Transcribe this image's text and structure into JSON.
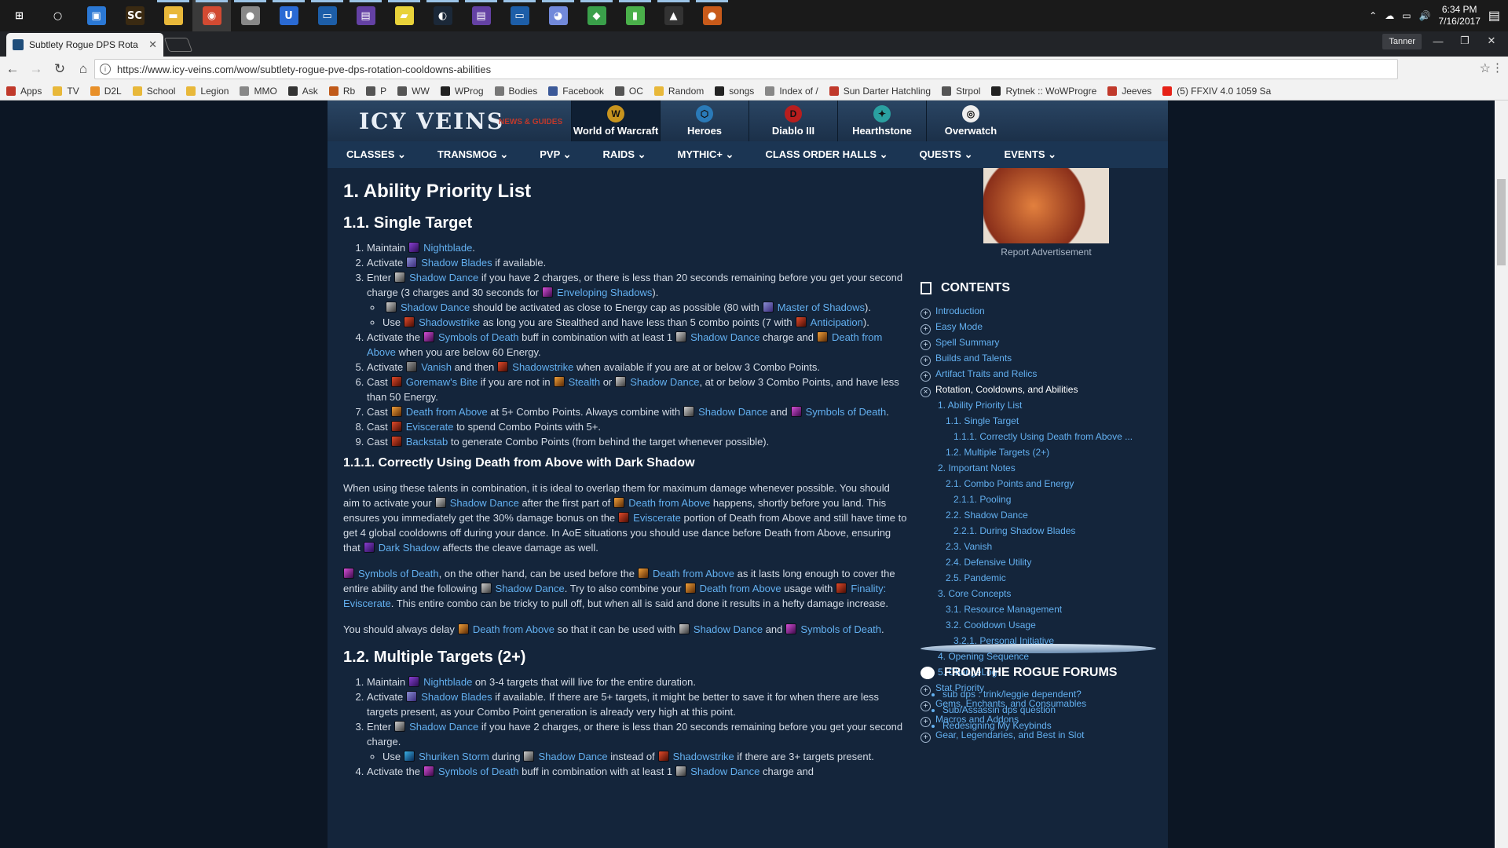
{
  "taskbar": {
    "apps": [
      {
        "name": "start",
        "glyph": "⊞",
        "color": "#1a1a1a"
      },
      {
        "name": "search",
        "glyph": "○",
        "color": "#1a1a1a"
      },
      {
        "name": "task-view",
        "glyph": "▣",
        "color": "#2b78d4"
      },
      {
        "name": "sc",
        "glyph": "SC",
        "color": "#3a2a12"
      },
      {
        "name": "file-explorer",
        "glyph": "▬",
        "color": "#e8b83a"
      },
      {
        "name": "chrome",
        "glyph": "◉",
        "color": "#d24a32"
      },
      {
        "name": "app-grey",
        "glyph": "●",
        "color": "#888888"
      },
      {
        "name": "uplay",
        "glyph": "U",
        "color": "#2a6ad4"
      },
      {
        "name": "terminal",
        "glyph": "▭",
        "color": "#1d5ea8"
      },
      {
        "name": "twitch",
        "glyph": "▤",
        "color": "#6441a4"
      },
      {
        "name": "sticky-notes",
        "glyph": "▰",
        "color": "#e8d23a"
      },
      {
        "name": "steam",
        "glyph": "◐",
        "color": "#1b2838"
      },
      {
        "name": "twitch-2",
        "glyph": "▤",
        "color": "#6441a4"
      },
      {
        "name": "terminal-2",
        "glyph": "▭",
        "color": "#1d5ea8"
      },
      {
        "name": "discord",
        "glyph": "◕",
        "color": "#7289da"
      },
      {
        "name": "app-green",
        "glyph": "◆",
        "color": "#3aa04a"
      },
      {
        "name": "app-green-2",
        "glyph": "▮",
        "color": "#4ab04a"
      },
      {
        "name": "photos",
        "glyph": "▲",
        "color": "#333333"
      },
      {
        "name": "app-orange",
        "glyph": "●",
        "color": "#c85a1a"
      }
    ],
    "clock_time": "6:34 PM",
    "clock_date": "7/16/2017"
  },
  "browser": {
    "tab_title": "Subtlety Rogue DPS Rota",
    "tab_close": "✕",
    "profile_name": "Tanner",
    "url": "https://www.icy-veins.com/wow/subtlety-rogue-pve-dps-rotation-cooldowns-abilities",
    "bookmarks": [
      {
        "label": "Apps",
        "color": "#c0392b"
      },
      {
        "label": "TV",
        "color": "#e8b83a"
      },
      {
        "label": "D2L",
        "color": "#e8902a"
      },
      {
        "label": "School",
        "color": "#e8b83a"
      },
      {
        "label": "Legion",
        "color": "#e8b83a"
      },
      {
        "label": "MMO",
        "color": "#888888"
      },
      {
        "label": "Ask",
        "color": "#333333"
      },
      {
        "label": "Rb",
        "color": "#c05a1a"
      },
      {
        "label": "P",
        "color": "#555555"
      },
      {
        "label": "WW",
        "color": "#555555"
      },
      {
        "label": "WProg",
        "color": "#222222"
      },
      {
        "label": "Bodies",
        "color": "#777777"
      },
      {
        "label": "Facebook",
        "color": "#3b5998"
      },
      {
        "label": "OC",
        "color": "#555555"
      },
      {
        "label": "Random",
        "color": "#e8b83a"
      },
      {
        "label": "songs",
        "color": "#222222"
      },
      {
        "label": "Index of /",
        "color": "#888888"
      },
      {
        "label": "Sun Darter Hatchling",
        "color": "#c0392b"
      },
      {
        "label": "Strpol",
        "color": "#555555"
      },
      {
        "label": "Rytnek :: WoWProgre",
        "color": "#222222"
      },
      {
        "label": "Jeeves",
        "color": "#c0392b"
      },
      {
        "label": "(5) FFXIV 4.0 1059 Sa",
        "color": "#e62117"
      }
    ]
  },
  "site": {
    "logo": "ICY VEINS",
    "logo_sub": "NEWS & GUIDES",
    "games": [
      {
        "label": "World of Warcraft",
        "glyph": "W",
        "color": "#c8941e",
        "selected": true
      },
      {
        "label": "Heroes",
        "glyph": "⬡",
        "color": "#2a7ab8"
      },
      {
        "label": "Diablo III",
        "glyph": "D",
        "color": "#b81e1e"
      },
      {
        "label": "Hearthstone",
        "glyph": "✦",
        "color": "#2aa0a0"
      },
      {
        "label": "Overwatch",
        "glyph": "◎",
        "color": "#eeeeee"
      }
    ],
    "nav": [
      "CLASSES ⌄",
      "TRANSMOG ⌄",
      "PVP ⌄",
      "RAIDS ⌄",
      "MYTHIC+ ⌄",
      "CLASS ORDER HALLS ⌄",
      "QUESTS ⌄",
      "EVENTS ⌄"
    ]
  },
  "article": {
    "h1": "1. Ability Priority List",
    "h2_single": "1.1. Single Target",
    "h3_dark": "1.1.1. Correctly Using Death from Above with Dark Shadow",
    "h2_multi": "1.2. Multiple Targets (2+)",
    "single": {
      "i1_a": "Maintain",
      "i1_sp": "Nightblade",
      "i1_b": ".",
      "i2_a": "Activate",
      "i2_sp": "Shadow Blades",
      "i2_b": "if available.",
      "i3_a": "Enter",
      "i3_sp1": "Shadow Dance",
      "i3_b": "if you have 2 charges, or there is less than 20 seconds remaining before you get your second charge (3 charges and 30 seconds for",
      "i3_sp2": "Enveloping Shadows",
      "i3_c": ").",
      "i3s1_sp1": "Shadow Dance",
      "i3s1_a": "should be activated as close to Energy cap as possible (80 with",
      "i3s1_sp2": "Master of Shadows",
      "i3s1_b": ").",
      "i3s2_a": "Use",
      "i3s2_sp1": "Shadowstrike",
      "i3s2_b": "as long you are Stealthed and have less than 5 combo points (7 with",
      "i3s2_sp2": "Anticipation",
      "i3s2_c": ").",
      "i4_a": "Activate the",
      "i4_sp1": "Symbols of Death",
      "i4_b": "buff in combination with at least 1",
      "i4_sp2": "Shadow Dance",
      "i4_c": "charge and",
      "i4_sp3": "Death from Above",
      "i4_d": "when you are below 60 Energy.",
      "i5_a": "Activate",
      "i5_sp1": "Vanish",
      "i5_b": "and then",
      "i5_sp2": "Shadowstrike",
      "i5_c": "when available if you are at or below 3 Combo Points.",
      "i6_a": "Cast",
      "i6_sp1": "Goremaw's Bite",
      "i6_b": "if you are not in",
      "i6_sp2": "Stealth",
      "i6_c": "or",
      "i6_sp3": "Shadow Dance",
      "i6_d": ", at or below 3 Combo Points, and have less than 50 Energy.",
      "i7_a": "Cast",
      "i7_sp1": "Death from Above",
      "i7_b": "at 5+ Combo Points. Always combine with",
      "i7_sp2": "Shadow Dance",
      "i7_c": "and",
      "i7_sp3": "Symbols of Death",
      "i7_d": ".",
      "i8_a": "Cast",
      "i8_sp": "Eviscerate",
      "i8_b": "to spend Combo Points with 5+.",
      "i9_a": "Cast",
      "i9_sp": "Backstab",
      "i9_b": "to generate Combo Points (from behind the target whenever possible)."
    },
    "dark": {
      "p1_a": "When using these talents in combination, it is ideal to overlap them for maximum damage whenever possible. You should aim to activate your",
      "p1_sp1": "Shadow Dance",
      "p1_b": "after the first part of",
      "p1_sp2": "Death from Above",
      "p1_c": "happens, shortly before you land. This ensures you immediately get the 30% damage bonus on the",
      "p1_sp3": "Eviscerate",
      "p1_d": "portion of Death from Above and still have time to get 4 global cooldowns off during your dance. In AoE situations you should use dance before Death from Above, ensuring that",
      "p1_sp4": "Dark Shadow",
      "p1_e": "affects the cleave damage as well.",
      "p2_sp1": "Symbols of Death",
      "p2_a": ", on the other hand, can be used before the",
      "p2_sp2": "Death from Above",
      "p2_b": "as it lasts long enough to cover the entire ability and the following",
      "p2_sp3": "Shadow Dance",
      "p2_c": ". Try to also combine your",
      "p2_sp4": "Death from Above",
      "p2_d": "usage with",
      "p2_sp5": "Finality: Eviscerate",
      "p2_e": ". This entire combo can be tricky to pull off, but when all is said and done it results in a hefty damage increase.",
      "p3_a": "You should always delay",
      "p3_sp1": "Death from Above",
      "p3_b": "so that it can be used with",
      "p3_sp2": "Shadow Dance",
      "p3_c": "and",
      "p3_sp3": "Symbols of Death",
      "p3_d": "."
    },
    "multi": {
      "i1_a": "Maintain",
      "i1_sp": "Nightblade",
      "i1_b": "on 3-4 targets that will live for the entire duration.",
      "i2_a": "Activate",
      "i2_sp": "Shadow Blades",
      "i2_b": "if available. If there are 5+ targets, it might be better to save it for when there are less targets present, as your Combo Point generation is already very high at this point.",
      "i3_a": "Enter",
      "i3_sp": "Shadow Dance",
      "i3_b": "if you have 2 charges, or there is less than 20 seconds remaining before you get your second charge.",
      "i3s1_a": "Use",
      "i3s1_sp1": "Shuriken Storm",
      "i3s1_b": "during",
      "i3s1_sp2": "Shadow Dance",
      "i3s1_c": "instead of",
      "i3s1_sp3": "Shadowstrike",
      "i3s1_d": "if there are 3+ targets present.",
      "i4_a": "Activate the",
      "i4_sp1": "Symbols of Death",
      "i4_b": "buff in combination with at least 1",
      "i4_sp2": "Shadow Dance",
      "i4_c": "charge and"
    }
  },
  "sidebar": {
    "ad_label": "Report Advertisement",
    "contents_title": "CONTENTS",
    "toc": [
      {
        "label": "Introduction",
        "indent": 0,
        "marker": "+"
      },
      {
        "label": "Easy Mode",
        "indent": 0,
        "marker": "+"
      },
      {
        "label": "Spell Summary",
        "indent": 0,
        "marker": "+"
      },
      {
        "label": "Builds and Talents",
        "indent": 0,
        "marker": "+"
      },
      {
        "label": "Artifact Traits and Relics",
        "indent": 0,
        "marker": "+"
      },
      {
        "label": "Rotation, Cooldowns, and Abilities",
        "indent": 0,
        "marker": "×",
        "current": true
      },
      {
        "label": "1. Ability Priority List",
        "indent": 1
      },
      {
        "label": "1.1. Single Target",
        "indent": 2
      },
      {
        "label": "1.1.1. Correctly Using Death from Above ...",
        "indent": 3
      },
      {
        "label": "1.2. Multiple Targets (2+)",
        "indent": 2
      },
      {
        "label": "2. Important Notes",
        "indent": 1
      },
      {
        "label": "2.1. Combo Points and Energy",
        "indent": 2
      },
      {
        "label": "2.1.1. Pooling",
        "indent": 3
      },
      {
        "label": "2.2. Shadow Dance",
        "indent": 2
      },
      {
        "label": "2.2.1. During Shadow Blades",
        "indent": 3
      },
      {
        "label": "2.3. Vanish",
        "indent": 2
      },
      {
        "label": "2.4. Defensive Utility",
        "indent": 2
      },
      {
        "label": "2.5. Pandemic",
        "indent": 2
      },
      {
        "label": "3. Core Concepts",
        "indent": 1
      },
      {
        "label": "3.1. Resource Management",
        "indent": 2
      },
      {
        "label": "3.2. Cooldown Usage",
        "indent": 2
      },
      {
        "label": "3.2.1. Personal Initiative",
        "indent": 3
      },
      {
        "label": "4. Opening Sequence",
        "indent": 1
      },
      {
        "label": "5. ChangeLog",
        "indent": 1
      },
      {
        "label": "Stat Priority",
        "indent": 0,
        "marker": "+"
      },
      {
        "label": "Gems, Enchants, and Consumables",
        "indent": 0,
        "marker": "+"
      },
      {
        "label": "Macros and Addons",
        "indent": 0,
        "marker": "+"
      },
      {
        "label": "Gear, Legendaries, and Best in Slot",
        "indent": 0,
        "marker": "+"
      }
    ],
    "forums_title": "FROM THE ROGUE FORUMS",
    "forums": [
      "sub dps : trink/leggie dependent?",
      "Sub/Assassin dps question",
      "Redesigning My Keybinds"
    ]
  }
}
